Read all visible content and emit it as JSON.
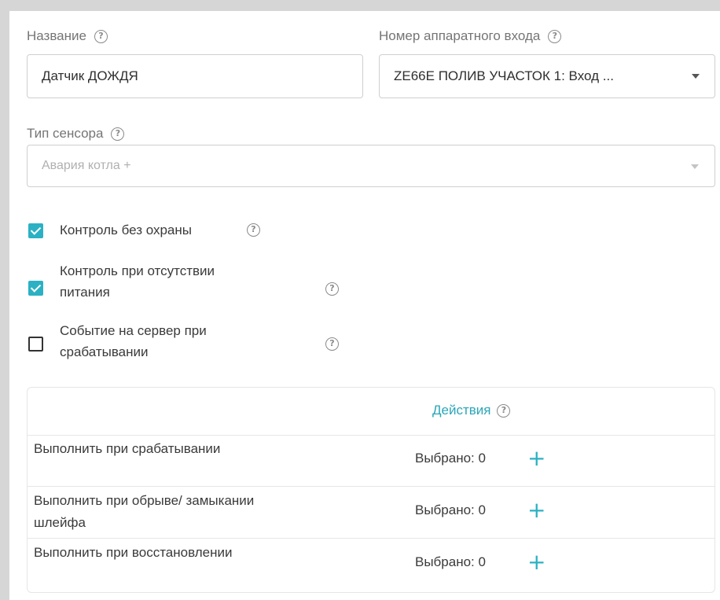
{
  "form": {
    "name": {
      "label": "Название",
      "value": "Датчик ДОЖДЯ"
    },
    "hardware_input": {
      "label": "Номер аппаратного входа",
      "value": "ZE66E ПОЛИВ УЧАСТОК 1: Вход ..."
    },
    "sensor_type": {
      "label": "Тип сенсора",
      "placeholder": "Авария котла +"
    },
    "checkboxes": [
      {
        "label": "Контроль без охраны",
        "checked": true
      },
      {
        "label": "Контроль при отсутствии\nпитания",
        "checked": true
      },
      {
        "label": "Событие на сервер при\nсрабатывании",
        "checked": false
      }
    ]
  },
  "actions_table": {
    "header": "Действия",
    "rows": [
      {
        "label": "Выполнить при срабатывании",
        "count": "Выбрано: 0",
        "add": "+"
      },
      {
        "label": "Выполнить при обрыве/ замыкании шлейфа",
        "count": "Выбрано: 0",
        "add": "+"
      },
      {
        "label": "Выполнить при восстановлении",
        "count": "Выбрано: 0",
        "add": "+"
      }
    ]
  },
  "help_symbol": "?",
  "colors": {
    "accent": "#2bb1c3",
    "link": "#2aa6b8",
    "border": "#cfcfcf"
  }
}
